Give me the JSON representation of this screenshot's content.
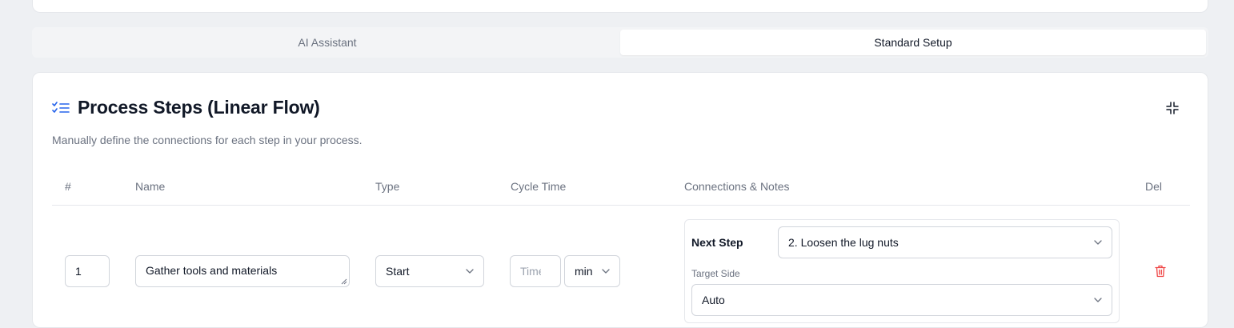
{
  "tabs": [
    {
      "label": "AI Assistant",
      "active": false
    },
    {
      "label": "Standard Setup",
      "active": true
    }
  ],
  "card": {
    "title": "Process Steps (Linear Flow)",
    "subtitle": "Manually define the connections for each step in your process."
  },
  "table": {
    "headers": [
      "#",
      "Name",
      "Type",
      "Cycle Time",
      "Connections & Notes",
      "Del"
    ],
    "row": {
      "number": "1",
      "name": "Gather tools and materials",
      "type": "Start",
      "cycle_time_placeholder": "Time",
      "cycle_unit": "min",
      "next_step_label": "Next Step",
      "next_step_value": "2. Loosen the lug nuts",
      "target_side_label": "Target Side",
      "target_side_value": "Auto"
    }
  },
  "colors": {
    "accent": "#2563eb",
    "delete": "#ef4444",
    "muted_text": "#6b7280",
    "border": "#d1d5db"
  },
  "icons": [
    "list-checks-icon",
    "collapse-icon",
    "chevron-down-icon",
    "trash-icon"
  ]
}
